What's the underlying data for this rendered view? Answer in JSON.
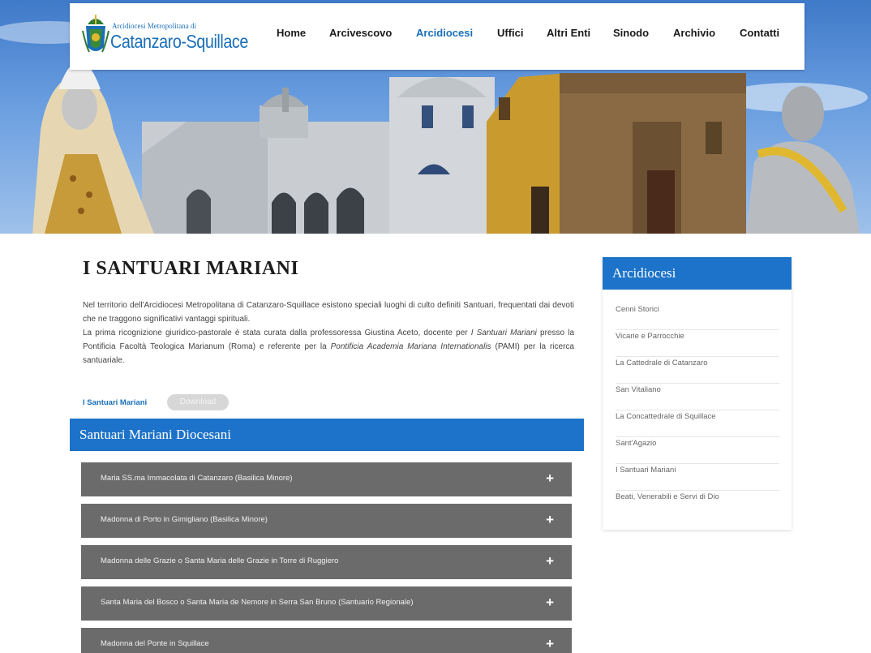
{
  "header": {
    "logo_small": "Arcidiocesi Metropolitana di",
    "logo_big": "Catanzaro-Squillace",
    "nav": [
      {
        "label": "Home",
        "active": false
      },
      {
        "label": "Arcivescovo",
        "active": false
      },
      {
        "label": "Arcidiocesi",
        "active": true
      },
      {
        "label": "Uffici",
        "active": false
      },
      {
        "label": "Altri Enti",
        "active": false
      },
      {
        "label": "Sinodo",
        "active": false
      },
      {
        "label": "Archivio",
        "active": false
      },
      {
        "label": "Contatti",
        "active": false
      }
    ]
  },
  "main": {
    "title": "I SANTUARI MARIANI",
    "intro_1": "Nel territorio dell'Arcidiocesi Metropolitana di Catanzaro-Squillace esistono speciali luoghi di culto definiti Santuari, frequentati dai devoti che ne traggono significativi vantaggi spirituali.",
    "intro_2a": "La prima ricognizione giuridico-pastorale è stata curata dalla professoressa Giustina Aceto, docente per ",
    "intro_2b": "I Santuari Mariani",
    "intro_2c": " presso la Pontificia Facoltà Teologica Marianum (Roma) e referente per la ",
    "intro_2d": "Pontificia Academia Mariana Internationalis",
    "intro_2e": " (PAMI) per la ricerca santuariale.",
    "download_label": "I Santuari Mariani",
    "download_button": "Download",
    "section_title": "Santuari Mariani Diocesani",
    "accordion": [
      "Maria SS.ma Immacolata di Catanzaro (Basilica Minore)",
      "Madonna di Porto in Gimigliano (Basilica Minore)",
      "Madonna delle Grazie o Santa Maria delle Grazie in Torre di Ruggiero",
      "Santa Maria del Bosco o Santa Maria de Nemore in Serra San Bruno (Santuario Regionale)",
      "Madonna del Ponte in Squillace"
    ],
    "plus_symbol": "+"
  },
  "sidebar": {
    "title": "Arcidiocesi",
    "items": [
      "Cenni Storici",
      "Vicarie e Parrocchie",
      "La Cattedrale di Catanzaro",
      "San Vitaliano",
      "La Concattedrale di Squillace",
      "Sant'Agazio",
      "I Santuari Mariani",
      "Beati, Venerabili e Servi di Dio"
    ]
  },
  "colors": {
    "brand_blue": "#1d73c9",
    "accordion_grey": "#6b6b6b"
  }
}
